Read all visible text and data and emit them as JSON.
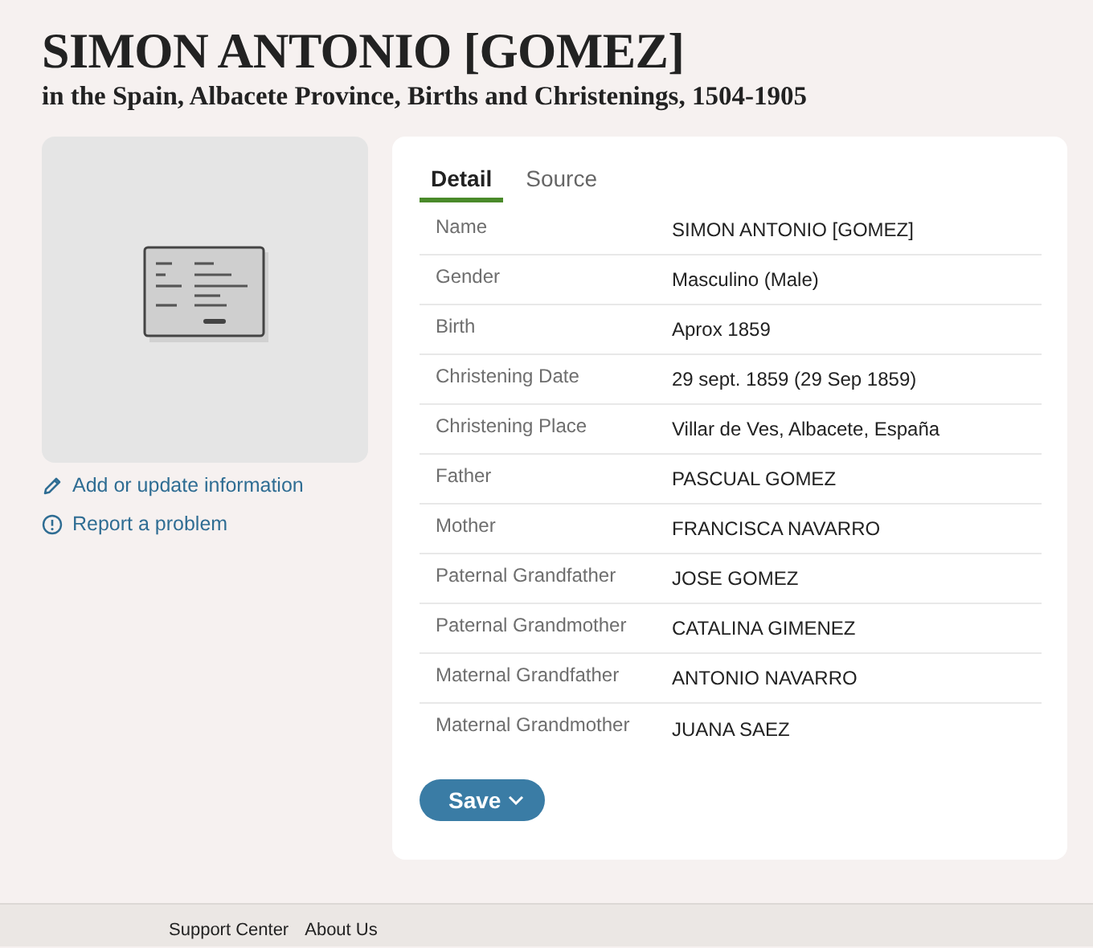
{
  "header": {
    "title": "SIMON ANTONIO [GOMEZ]",
    "subtitle": "in the Spain, Albacete Province, Births and Christenings, 1504-1905"
  },
  "side_links": [
    {
      "kind": "edit",
      "label": "Add or update information"
    },
    {
      "kind": "report",
      "label": "Report a problem"
    }
  ],
  "tabs": [
    {
      "label": "Detail",
      "selected": true
    },
    {
      "label": "Source",
      "selected": false
    }
  ],
  "fields": [
    {
      "label": "Name",
      "value": "SIMON ANTONIO [GOMEZ]"
    },
    {
      "label": "Gender",
      "value": "Masculino (Male)"
    },
    {
      "label": "Birth",
      "value": "Aprox 1859"
    },
    {
      "label": "Christening Date",
      "value": "29 sept. 1859 (29 Sep 1859)"
    },
    {
      "label": "Christening Place",
      "value": "Villar de Ves, Albacete, España"
    },
    {
      "label": "Father",
      "value": "PASCUAL GOMEZ"
    },
    {
      "label": "Mother",
      "value": "FRANCISCA NAVARRO"
    },
    {
      "label": "Paternal Grandfather",
      "value": "JOSE GOMEZ"
    },
    {
      "label": "Paternal Grandmother",
      "value": "CATALINA GIMENEZ"
    },
    {
      "label": "Maternal Grandfather",
      "value": "ANTONIO NAVARRO"
    },
    {
      "label": "Maternal Grandmother",
      "value": "JUANA SAEZ"
    }
  ],
  "save_button": {
    "label": "Save"
  },
  "footer_links": [
    "Support Center",
    "About Us"
  ]
}
